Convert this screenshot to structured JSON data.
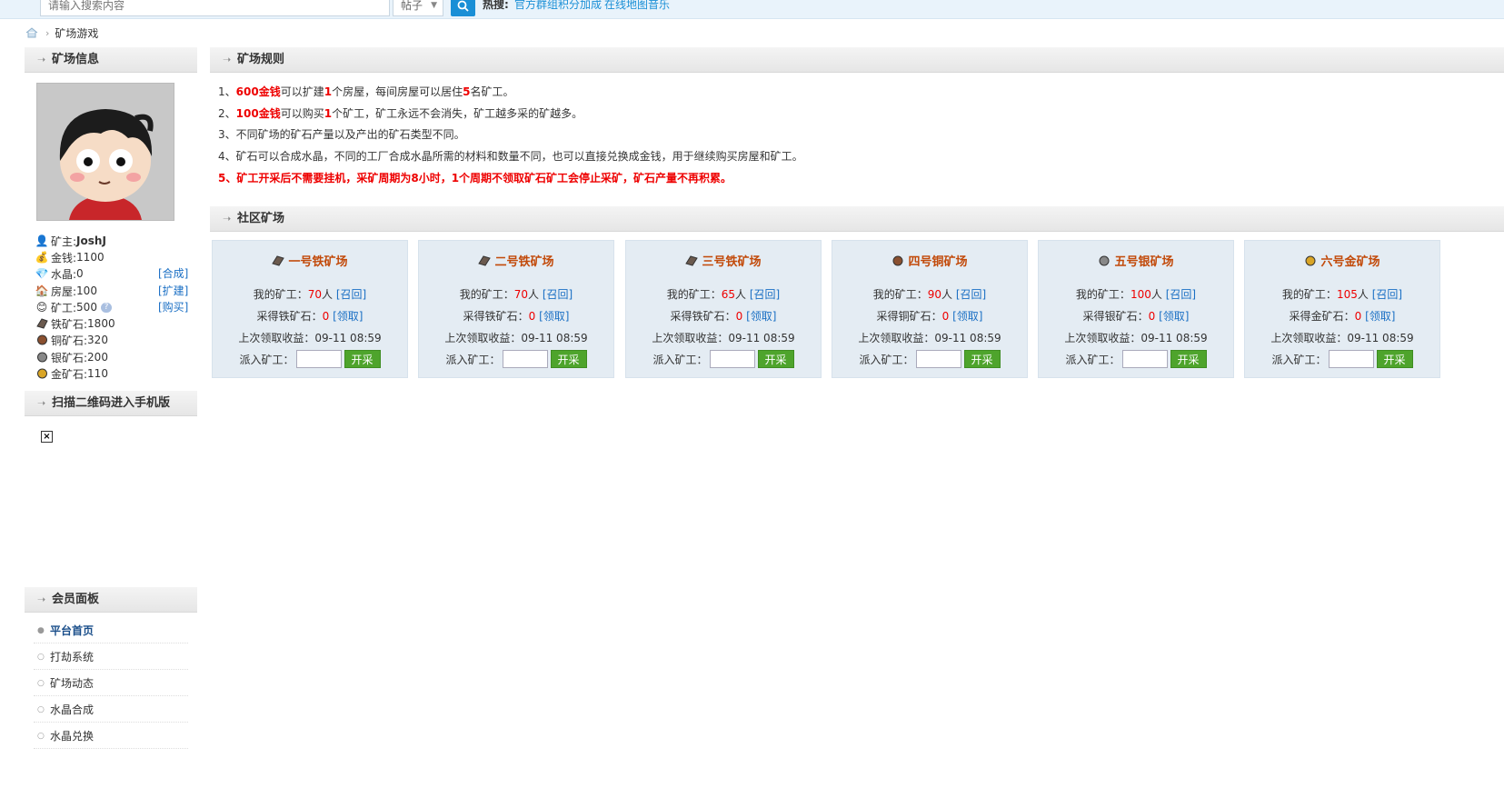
{
  "search": {
    "placeholder": "请输入搜索内容",
    "select_value": "帖子",
    "hot_label": "热搜:",
    "hot_links": [
      "官方群组积分加成",
      "在线地图音乐"
    ]
  },
  "breadcrumb": {
    "current": "矿场游戏"
  },
  "left": {
    "mine_info_title": "矿场信息",
    "owner": {
      "label": "矿主: ",
      "value": "JoshJ"
    },
    "gold": {
      "label": "金钱: ",
      "value": "1100"
    },
    "crystal": {
      "label": "水晶: ",
      "value": "0",
      "action": "[合成]"
    },
    "house": {
      "label": "房屋: ",
      "value": "100",
      "action": "[扩建]"
    },
    "miner": {
      "label": "矿工: ",
      "value": "500",
      "action": "[购买]"
    },
    "iron_ore": {
      "label": "铁矿石: ",
      "value": "1800"
    },
    "copper_ore": {
      "label": "铜矿石: ",
      "value": "320"
    },
    "silver_ore": {
      "label": "银矿石: ",
      "value": "200"
    },
    "gold_ore": {
      "label": "金矿石: ",
      "value": "110"
    },
    "qr_title": "扫描二维码进入手机版",
    "member_title": "会员面板",
    "menu": [
      "平台首页",
      "打劫系统",
      "矿场动态",
      "水晶合成",
      "水晶兑换"
    ]
  },
  "rules": {
    "title": "矿场规则",
    "r1": {
      "pre": "1、",
      "money": "600金钱",
      "a": "可以扩建",
      "n1": "1",
      "b": "个房屋，每间房屋可以居住",
      "n2": "5",
      "c": "名矿工。"
    },
    "r2": {
      "pre": "2、",
      "money": "100金钱",
      "a": "可以购买",
      "n1": "1",
      "b": "个矿工，矿工永远不会消失，矿工越多采的矿越多。"
    },
    "r3": "3、不同矿场的矿石产量以及产出的矿石类型不同。",
    "r4": "4、矿石可以合成水晶，不同的工厂合成水晶所需的材料和数量不同，也可以直接兑换成金钱，用于继续购买房屋和矿工。",
    "r5": "5、矿工开采后不需要挂机，采矿周期为8小时，1个周期不领取矿石矿工会停止采矿，矿石产量不再积累。"
  },
  "community": {
    "title": "社区矿场",
    "mines": [
      {
        "name": "一号铁矿场",
        "ore": "铁",
        "icon": "iron-ore-icon",
        "miners": "70",
        "collected": "0",
        "time": "09-11 08:59"
      },
      {
        "name": "二号铁矿场",
        "ore": "铁",
        "icon": "iron-ore-icon",
        "miners": "70",
        "collected": "0",
        "time": "09-11 08:59"
      },
      {
        "name": "三号铁矿场",
        "ore": "铁",
        "icon": "iron-ore-icon",
        "miners": "65",
        "collected": "0",
        "time": "09-11 08:59"
      },
      {
        "name": "四号铜矿场",
        "ore": "铜",
        "icon": "copper-ore-icon",
        "miners": "90",
        "collected": "0",
        "time": "09-11 08:59"
      },
      {
        "name": "五号银矿场",
        "ore": "银",
        "icon": "silver-ore-icon",
        "miners": "100",
        "collected": "0",
        "time": "09-11 08:59"
      },
      {
        "name": "六号金矿场",
        "ore": "金",
        "icon": "gold-ore-icon",
        "miners": "105",
        "collected": "0",
        "time": "09-11 08:59"
      }
    ],
    "labels": {
      "my_miners": "我的矿工：",
      "people": "人",
      "recall": "[召回]",
      "collected_pre": "采得",
      "collected_post": "矿石：",
      "claim": "[领取]",
      "last_claim": "上次领取收益：",
      "dispatch": "派入矿工：",
      "start": "开采"
    }
  },
  "colors": {
    "accent_blue": "#1a8fd6",
    "red": "#e00000",
    "mine_title": "#c24a0a",
    "start_green": "#4ea42c"
  }
}
